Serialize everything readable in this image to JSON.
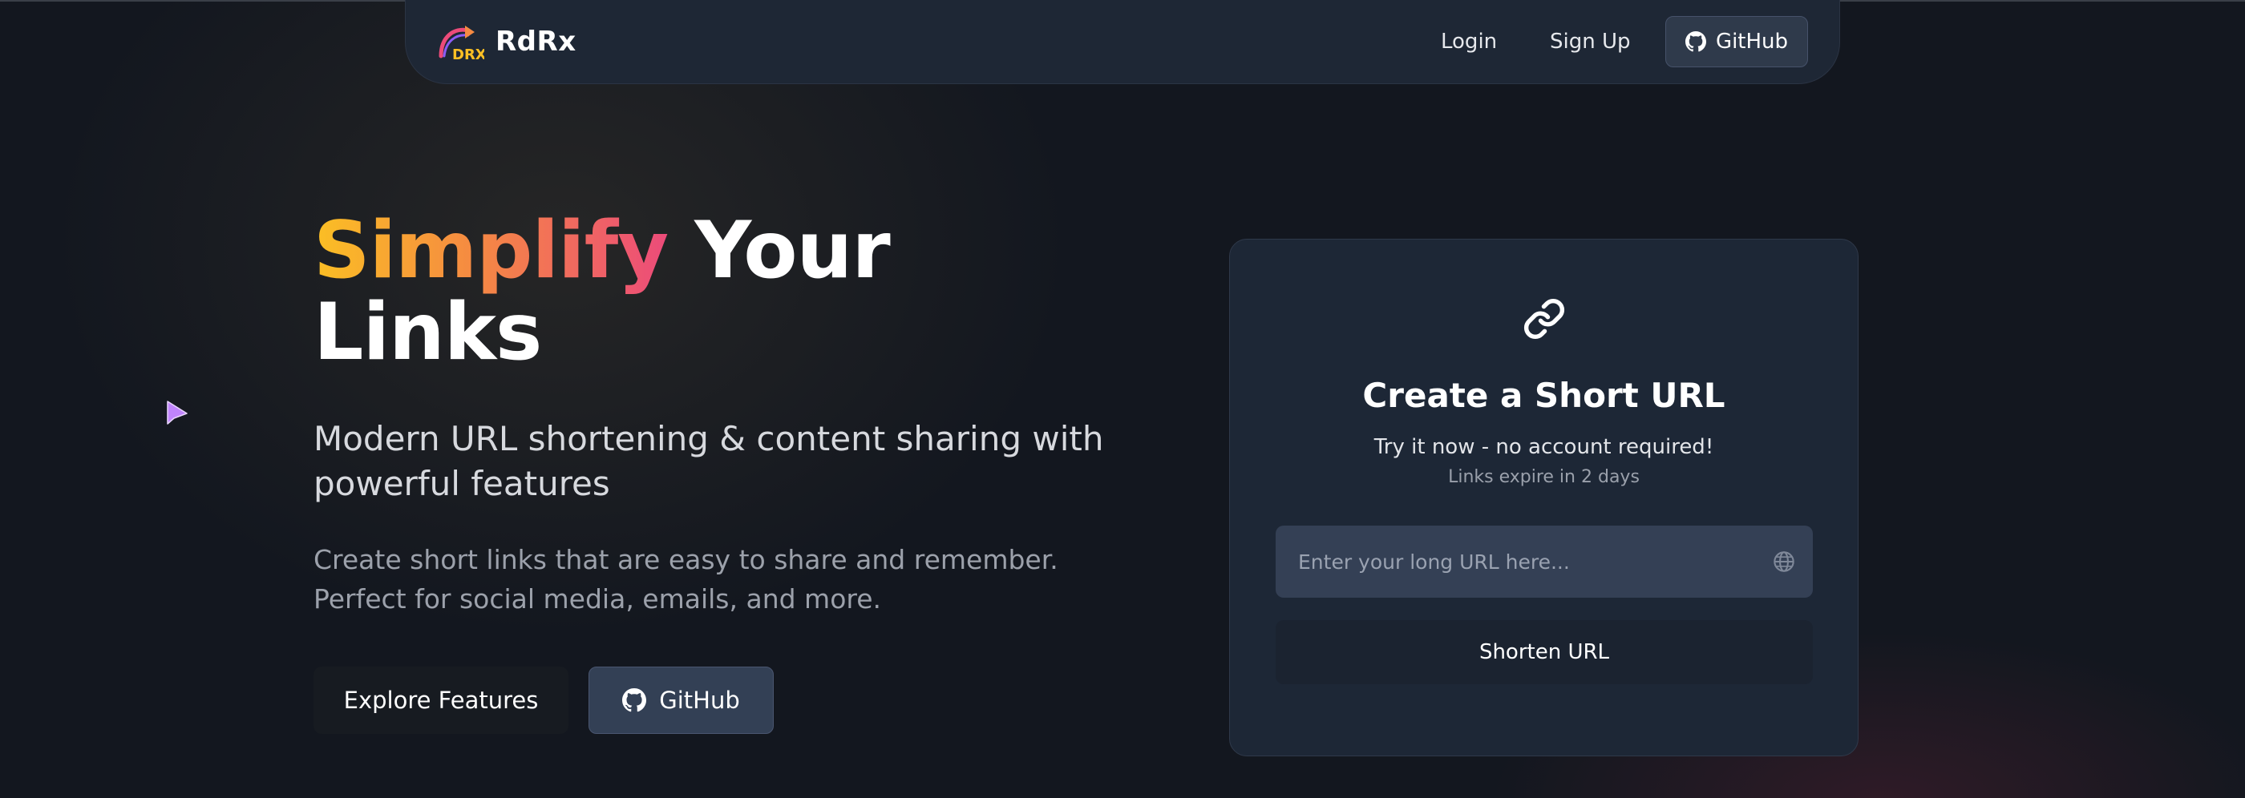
{
  "brand": {
    "name": "RdRx",
    "logo_icon": "rdrx-logo-icon"
  },
  "nav": {
    "login": "Login",
    "signup": "Sign Up",
    "github": "GitHub",
    "github_icon": "github-icon"
  },
  "hero": {
    "title_highlight": "Simplify",
    "title_rest_1": "Your",
    "title_rest_2": "Links",
    "subtitle": "Modern URL shortening & content sharing with powerful features",
    "description": "Create short links that are easy to share and remember. Perfect for social media, emails, and more.",
    "explore_button": "Explore Features",
    "github_button": "GitHub"
  },
  "card": {
    "icon": "link-icon",
    "title": "Create a Short URL",
    "subtitle": "Try it now - no account required!",
    "note": "Links expire in 2 days",
    "input_placeholder": "Enter your long URL here...",
    "input_value": "",
    "input_icon": "globe-icon",
    "submit": "Shorten URL"
  },
  "colors": {
    "background": "#13171f",
    "nav_bg": "#1e2735",
    "card_bg": "#1d2736",
    "gradient_start": "#fbbf24",
    "gradient_end": "#ec4b7a",
    "button_secondary": "#334055"
  }
}
